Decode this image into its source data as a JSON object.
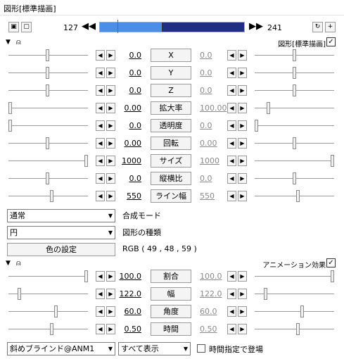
{
  "window": {
    "title": "図形[標準描画]"
  },
  "timeline": {
    "start": "127",
    "end": "241",
    "marker_fraction": 0.12,
    "tick_fraction": 0.43
  },
  "section1": {
    "name": "図形[標準描画]",
    "checked": "✓"
  },
  "params1": [
    {
      "label": "X",
      "left": "0.0",
      "right": "0.0",
      "lk": 0.49,
      "rk": 0.5
    },
    {
      "label": "Y",
      "left": "0.0",
      "right": "0.0",
      "lk": 0.49,
      "rk": 0.5
    },
    {
      "label": "Z",
      "left": "0.0",
      "right": "0.0",
      "lk": 0.49,
      "rk": 0.5
    },
    {
      "label": "拡大率",
      "left": "0.00",
      "right": "100.00",
      "lk": 0.0,
      "rk": 0.16
    },
    {
      "label": "透明度",
      "left": "0.0",
      "right": "0.0",
      "lk": 0.0,
      "rk": 0.0
    },
    {
      "label": "回転",
      "left": "0.00",
      "right": "0.00",
      "lk": 0.49,
      "rk": 0.5
    },
    {
      "label": "サイズ",
      "left": "1000",
      "right": "1000",
      "lk": 1.0,
      "rk": 1.0
    },
    {
      "label": "縦横比",
      "left": "0.0",
      "right": "0.0",
      "lk": 0.49,
      "rk": 0.5
    },
    {
      "label": "ライン幅",
      "left": "550",
      "right": "550",
      "lk": 0.55,
      "rk": 0.55
    }
  ],
  "blend": {
    "value": "通常",
    "label": "合成モード"
  },
  "shape": {
    "value": "円",
    "label": "図形の種類"
  },
  "color": {
    "button": "色の設定",
    "rgb": "RGB ( 49 , 48 , 59 )"
  },
  "section2": {
    "name": "アニメーション効果",
    "checked": "✓"
  },
  "params2": [
    {
      "label": "割合",
      "left": "100.0",
      "right": "100.0",
      "lk": 1.0,
      "rk": 1.0
    },
    {
      "label": "幅",
      "left": "122.0",
      "right": "122.0",
      "lk": 0.12,
      "rk": 0.12
    },
    {
      "label": "角度",
      "left": "60.0",
      "right": "60.0",
      "lk": 0.6,
      "rk": 0.6
    },
    {
      "label": "時間",
      "left": "0.50",
      "right": "0.50",
      "lk": 0.55,
      "rk": 0.55
    }
  ],
  "anim": {
    "effect": "斜めブラインド@ANM1",
    "display": "すべて表示",
    "timing_label": "時間指定で登場"
  },
  "icons": {
    "left_arrow": "◀",
    "right_arrow": "▶",
    "skip_left": "⏮",
    "skip_right": "⏭",
    "triangle": "▼",
    "mouse": "🖰",
    "dropdown": "▼"
  }
}
